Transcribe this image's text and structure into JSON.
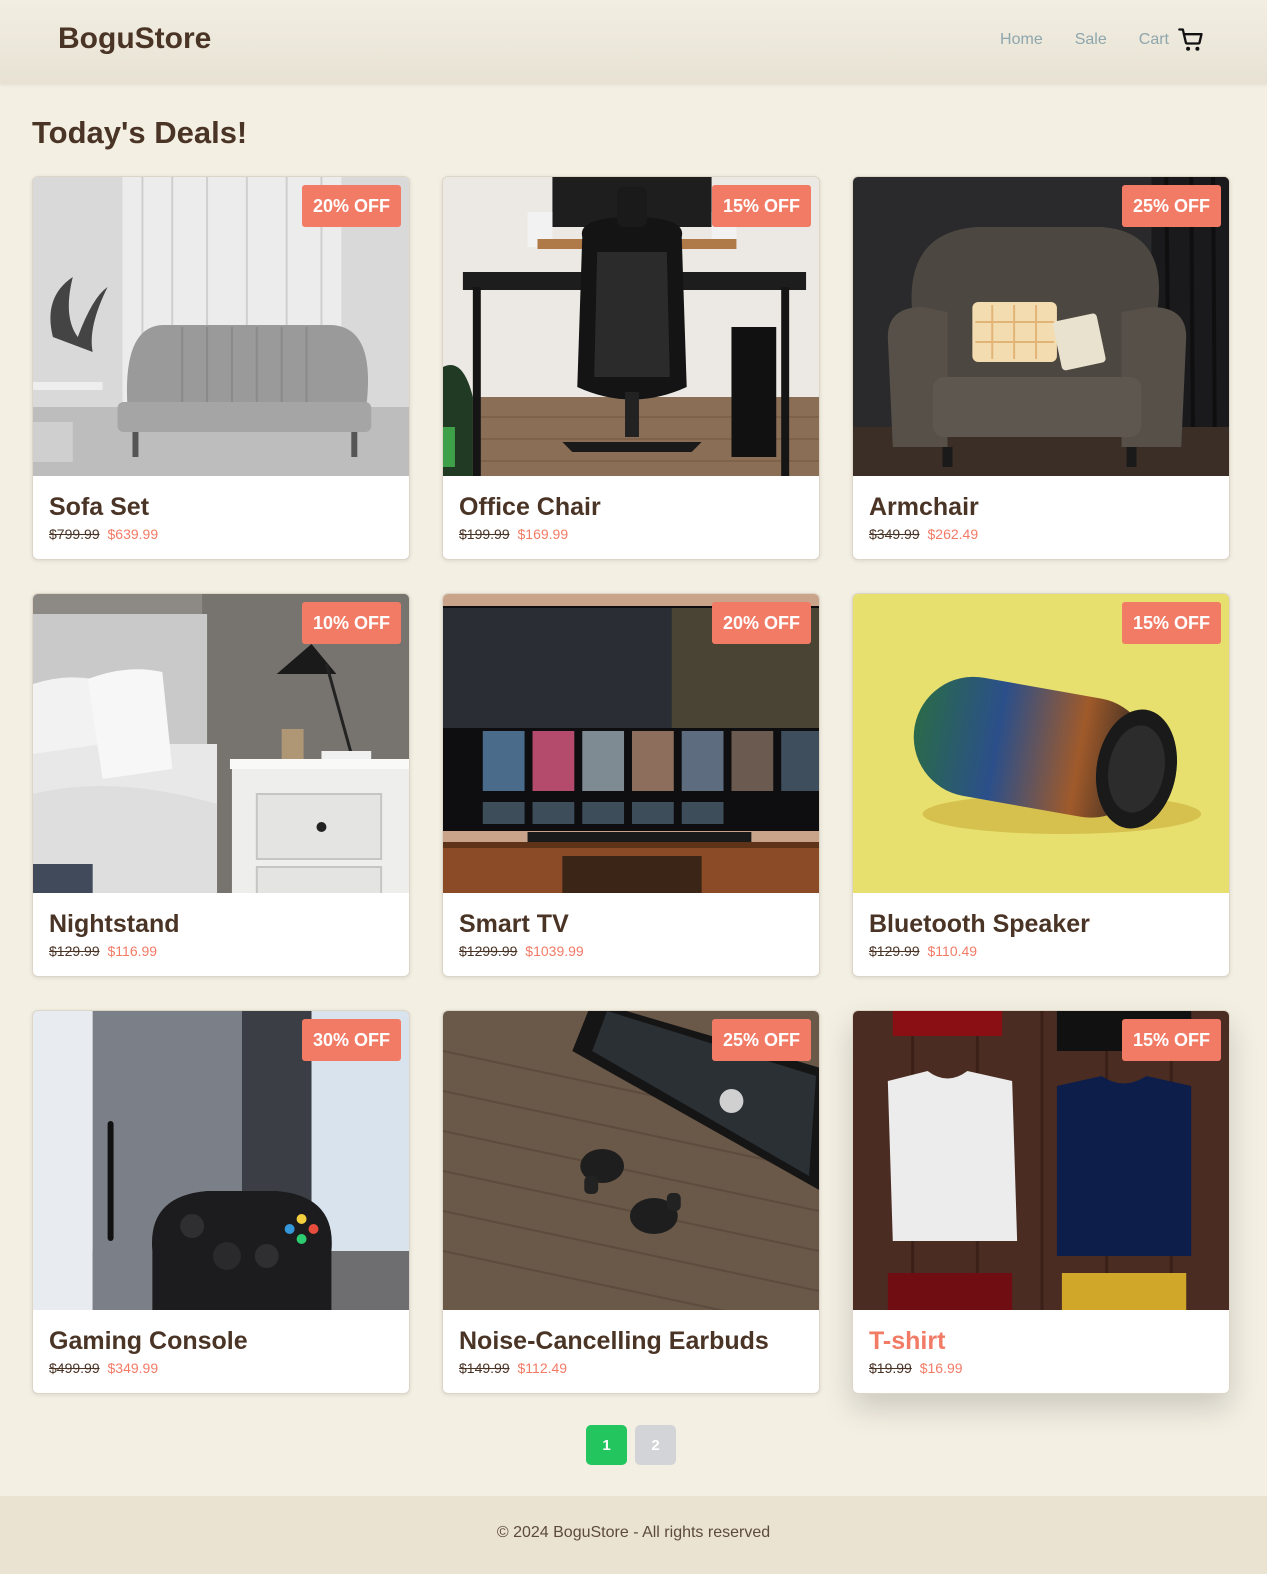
{
  "header": {
    "brand": "BoguStore",
    "nav": {
      "home": "Home",
      "sale": "Sale",
      "cart": "Cart"
    }
  },
  "page_title": "Today's Deals!",
  "products": [
    {
      "name": "Sofa Set",
      "badge": "20% OFF",
      "old_price": "$799.99",
      "new_price": "$639.99",
      "image": "sofa"
    },
    {
      "name": "Office Chair",
      "badge": "15% OFF",
      "old_price": "$199.99",
      "new_price": "$169.99",
      "image": "office-chair"
    },
    {
      "name": "Armchair",
      "badge": "25% OFF",
      "old_price": "$349.99",
      "new_price": "$262.49",
      "image": "armchair"
    },
    {
      "name": "Nightstand",
      "badge": "10% OFF",
      "old_price": "$129.99",
      "new_price": "$116.99",
      "image": "nightstand"
    },
    {
      "name": "Smart TV",
      "badge": "20% OFF",
      "old_price": "$1299.99",
      "new_price": "$1039.99",
      "image": "smart-tv"
    },
    {
      "name": "Bluetooth Speaker",
      "badge": "15% OFF",
      "old_price": "$129.99",
      "new_price": "$110.49",
      "image": "speaker"
    },
    {
      "name": "Gaming Console",
      "badge": "30% OFF",
      "old_price": "$499.99",
      "new_price": "$349.99",
      "image": "console"
    },
    {
      "name": "Noise-Cancelling Earbuds",
      "badge": "25% OFF",
      "old_price": "$149.99",
      "new_price": "$112.49",
      "image": "earbuds"
    },
    {
      "name": "T-shirt",
      "badge": "15% OFF",
      "old_price": "$19.99",
      "new_price": "$16.99",
      "image": "tshirt"
    }
  ],
  "pagination": {
    "pages": [
      "1",
      "2"
    ],
    "current": "1"
  },
  "footer": {
    "text": "© 2024 BoguStore - All rights reserved"
  },
  "colors": {
    "accent": "#f27b66",
    "active_page": "#22c55e",
    "brown": "#4a3426",
    "background": "#f3efe3"
  }
}
